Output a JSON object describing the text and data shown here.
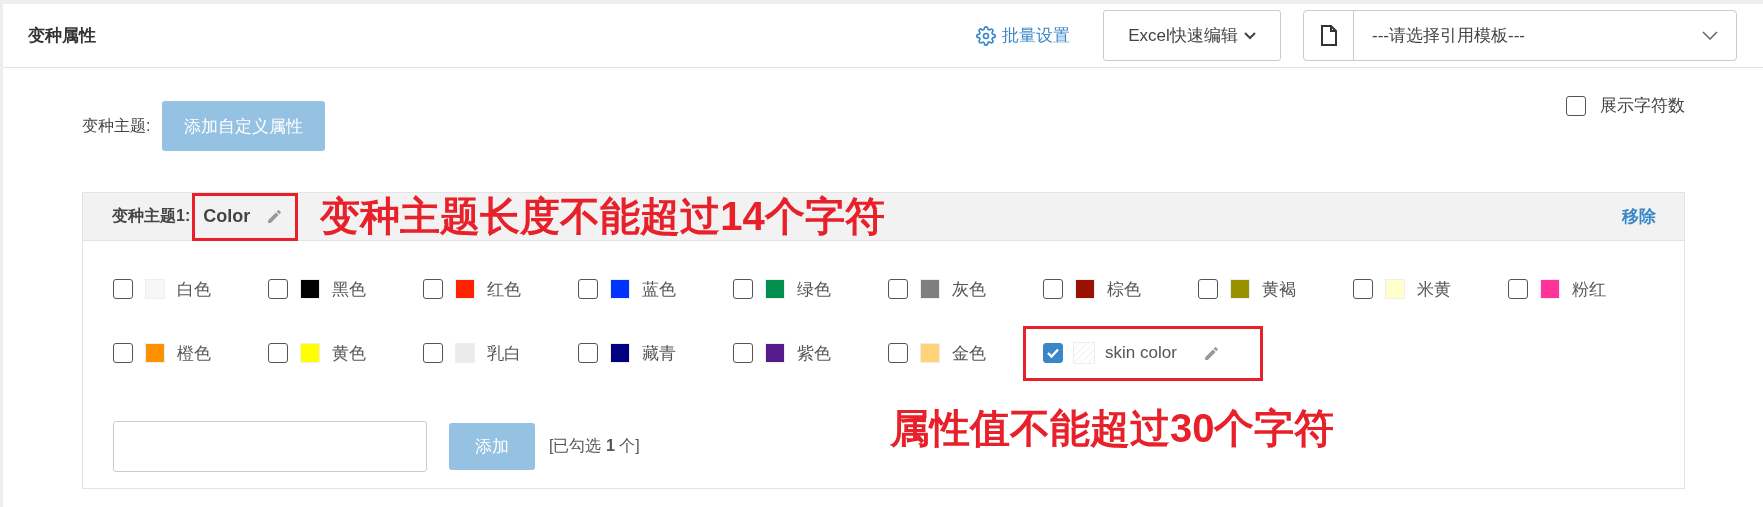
{
  "header": {
    "title": "变种属性",
    "batch_link": "批量设置",
    "excel_button": "Excel快速编辑",
    "template_select": {
      "value": "---请选择引用模板---"
    }
  },
  "theme_bar": {
    "label": "变种主题:",
    "add_button": "添加自定义属性",
    "show_count": {
      "label": "展示字符数",
      "checked": false
    }
  },
  "theme_panel": {
    "label": "变种主题1:",
    "name": "Color",
    "remove": "移除",
    "options": [
      {
        "kind": "color",
        "label": "白色",
        "color": "#f7f7f7",
        "checked": false
      },
      {
        "kind": "color",
        "label": "黑色",
        "color": "#000000",
        "checked": false
      },
      {
        "kind": "color",
        "label": "红色",
        "color": "#ff2200",
        "checked": false
      },
      {
        "kind": "color",
        "label": "蓝色",
        "color": "#0033ff",
        "checked": false
      },
      {
        "kind": "color",
        "label": "绿色",
        "color": "#008f4c",
        "checked": false
      },
      {
        "kind": "color",
        "label": "灰色",
        "color": "#7f7f7f",
        "checked": false
      },
      {
        "kind": "color",
        "label": "棕色",
        "color": "#991100",
        "checked": false
      },
      {
        "kind": "color",
        "label": "黄褐",
        "color": "#999100",
        "checked": false
      },
      {
        "kind": "color",
        "label": "米黄",
        "color": "#ffffcc",
        "checked": false
      },
      {
        "kind": "color",
        "label": "粉红",
        "color": "#ff3399",
        "checked": false
      },
      {
        "kind": "color",
        "label": "橙色",
        "color": "#ff9100",
        "checked": false
      },
      {
        "kind": "color",
        "label": "黄色",
        "color": "#ffff00",
        "checked": false
      },
      {
        "kind": "color",
        "label": "乳白",
        "color": "#ebebeb",
        "checked": false
      },
      {
        "kind": "color",
        "label": "藏青",
        "color": "#000080",
        "checked": false
      },
      {
        "kind": "color",
        "label": "紫色",
        "color": "#551a8b",
        "checked": false
      },
      {
        "kind": "color",
        "label": "金色",
        "color": "#ffd479",
        "checked": false
      },
      {
        "kind": "custom",
        "label": "skin color",
        "checked": true
      }
    ],
    "add_button": "添加",
    "selected_count": "[已勾选 **1** 个]"
  },
  "annotations": [
    "变种主题长度不能超过14个字符",
    "属性值不能超过30个字符"
  ]
}
